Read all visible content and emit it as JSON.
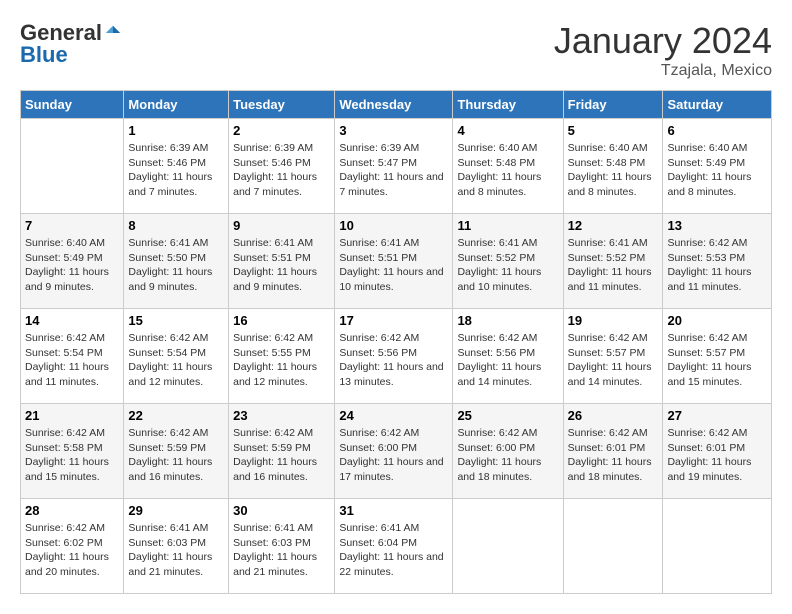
{
  "logo": {
    "general": "General",
    "blue": "Blue"
  },
  "header": {
    "month": "January 2024",
    "location": "Tzajala, Mexico"
  },
  "weekdays": [
    "Sunday",
    "Monday",
    "Tuesday",
    "Wednesday",
    "Thursday",
    "Friday",
    "Saturday"
  ],
  "weeks": [
    [
      {
        "day": "",
        "sunrise": "",
        "sunset": "",
        "daylight": ""
      },
      {
        "day": "1",
        "sunrise": "Sunrise: 6:39 AM",
        "sunset": "Sunset: 5:46 PM",
        "daylight": "Daylight: 11 hours and 7 minutes."
      },
      {
        "day": "2",
        "sunrise": "Sunrise: 6:39 AM",
        "sunset": "Sunset: 5:46 PM",
        "daylight": "Daylight: 11 hours and 7 minutes."
      },
      {
        "day": "3",
        "sunrise": "Sunrise: 6:39 AM",
        "sunset": "Sunset: 5:47 PM",
        "daylight": "Daylight: 11 hours and 7 minutes."
      },
      {
        "day": "4",
        "sunrise": "Sunrise: 6:40 AM",
        "sunset": "Sunset: 5:48 PM",
        "daylight": "Daylight: 11 hours and 8 minutes."
      },
      {
        "day": "5",
        "sunrise": "Sunrise: 6:40 AM",
        "sunset": "Sunset: 5:48 PM",
        "daylight": "Daylight: 11 hours and 8 minutes."
      },
      {
        "day": "6",
        "sunrise": "Sunrise: 6:40 AM",
        "sunset": "Sunset: 5:49 PM",
        "daylight": "Daylight: 11 hours and 8 minutes."
      }
    ],
    [
      {
        "day": "7",
        "sunrise": "Sunrise: 6:40 AM",
        "sunset": "Sunset: 5:49 PM",
        "daylight": "Daylight: 11 hours and 9 minutes."
      },
      {
        "day": "8",
        "sunrise": "Sunrise: 6:41 AM",
        "sunset": "Sunset: 5:50 PM",
        "daylight": "Daylight: 11 hours and 9 minutes."
      },
      {
        "day": "9",
        "sunrise": "Sunrise: 6:41 AM",
        "sunset": "Sunset: 5:51 PM",
        "daylight": "Daylight: 11 hours and 9 minutes."
      },
      {
        "day": "10",
        "sunrise": "Sunrise: 6:41 AM",
        "sunset": "Sunset: 5:51 PM",
        "daylight": "Daylight: 11 hours and 10 minutes."
      },
      {
        "day": "11",
        "sunrise": "Sunrise: 6:41 AM",
        "sunset": "Sunset: 5:52 PM",
        "daylight": "Daylight: 11 hours and 10 minutes."
      },
      {
        "day": "12",
        "sunrise": "Sunrise: 6:41 AM",
        "sunset": "Sunset: 5:52 PM",
        "daylight": "Daylight: 11 hours and 11 minutes."
      },
      {
        "day": "13",
        "sunrise": "Sunrise: 6:42 AM",
        "sunset": "Sunset: 5:53 PM",
        "daylight": "Daylight: 11 hours and 11 minutes."
      }
    ],
    [
      {
        "day": "14",
        "sunrise": "Sunrise: 6:42 AM",
        "sunset": "Sunset: 5:54 PM",
        "daylight": "Daylight: 11 hours and 11 minutes."
      },
      {
        "day": "15",
        "sunrise": "Sunrise: 6:42 AM",
        "sunset": "Sunset: 5:54 PM",
        "daylight": "Daylight: 11 hours and 12 minutes."
      },
      {
        "day": "16",
        "sunrise": "Sunrise: 6:42 AM",
        "sunset": "Sunset: 5:55 PM",
        "daylight": "Daylight: 11 hours and 12 minutes."
      },
      {
        "day": "17",
        "sunrise": "Sunrise: 6:42 AM",
        "sunset": "Sunset: 5:56 PM",
        "daylight": "Daylight: 11 hours and 13 minutes."
      },
      {
        "day": "18",
        "sunrise": "Sunrise: 6:42 AM",
        "sunset": "Sunset: 5:56 PM",
        "daylight": "Daylight: 11 hours and 14 minutes."
      },
      {
        "day": "19",
        "sunrise": "Sunrise: 6:42 AM",
        "sunset": "Sunset: 5:57 PM",
        "daylight": "Daylight: 11 hours and 14 minutes."
      },
      {
        "day": "20",
        "sunrise": "Sunrise: 6:42 AM",
        "sunset": "Sunset: 5:57 PM",
        "daylight": "Daylight: 11 hours and 15 minutes."
      }
    ],
    [
      {
        "day": "21",
        "sunrise": "Sunrise: 6:42 AM",
        "sunset": "Sunset: 5:58 PM",
        "daylight": "Daylight: 11 hours and 15 minutes."
      },
      {
        "day": "22",
        "sunrise": "Sunrise: 6:42 AM",
        "sunset": "Sunset: 5:59 PM",
        "daylight": "Daylight: 11 hours and 16 minutes."
      },
      {
        "day": "23",
        "sunrise": "Sunrise: 6:42 AM",
        "sunset": "Sunset: 5:59 PM",
        "daylight": "Daylight: 11 hours and 16 minutes."
      },
      {
        "day": "24",
        "sunrise": "Sunrise: 6:42 AM",
        "sunset": "Sunset: 6:00 PM",
        "daylight": "Daylight: 11 hours and 17 minutes."
      },
      {
        "day": "25",
        "sunrise": "Sunrise: 6:42 AM",
        "sunset": "Sunset: 6:00 PM",
        "daylight": "Daylight: 11 hours and 18 minutes."
      },
      {
        "day": "26",
        "sunrise": "Sunrise: 6:42 AM",
        "sunset": "Sunset: 6:01 PM",
        "daylight": "Daylight: 11 hours and 18 minutes."
      },
      {
        "day": "27",
        "sunrise": "Sunrise: 6:42 AM",
        "sunset": "Sunset: 6:01 PM",
        "daylight": "Daylight: 11 hours and 19 minutes."
      }
    ],
    [
      {
        "day": "28",
        "sunrise": "Sunrise: 6:42 AM",
        "sunset": "Sunset: 6:02 PM",
        "daylight": "Daylight: 11 hours and 20 minutes."
      },
      {
        "day": "29",
        "sunrise": "Sunrise: 6:41 AM",
        "sunset": "Sunset: 6:03 PM",
        "daylight": "Daylight: 11 hours and 21 minutes."
      },
      {
        "day": "30",
        "sunrise": "Sunrise: 6:41 AM",
        "sunset": "Sunset: 6:03 PM",
        "daylight": "Daylight: 11 hours and 21 minutes."
      },
      {
        "day": "31",
        "sunrise": "Sunrise: 6:41 AM",
        "sunset": "Sunset: 6:04 PM",
        "daylight": "Daylight: 11 hours and 22 minutes."
      },
      {
        "day": "",
        "sunrise": "",
        "sunset": "",
        "daylight": ""
      },
      {
        "day": "",
        "sunrise": "",
        "sunset": "",
        "daylight": ""
      },
      {
        "day": "",
        "sunrise": "",
        "sunset": "",
        "daylight": ""
      }
    ]
  ]
}
